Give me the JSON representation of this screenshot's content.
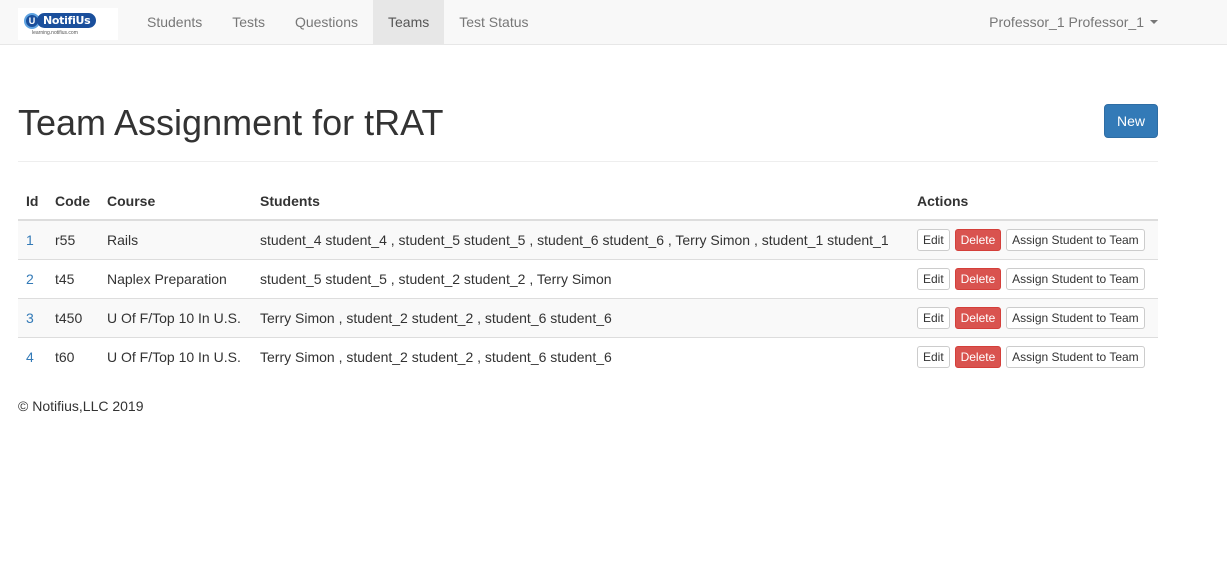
{
  "brand": {
    "name": "NotifiUs",
    "letter": "U",
    "tagline": "learning.notifius.com"
  },
  "nav": {
    "items": [
      {
        "label": "Students"
      },
      {
        "label": "Tests"
      },
      {
        "label": "Questions"
      },
      {
        "label": "Teams",
        "active": true
      },
      {
        "label": "Test Status"
      }
    ],
    "user": "Professor_1 Professor_1"
  },
  "page": {
    "title": "Team Assignment for tRAT",
    "new_label": "New"
  },
  "table": {
    "headers": {
      "id": "Id",
      "code": "Code",
      "course": "Course",
      "students": "Students",
      "actions": "Actions"
    },
    "buttons": {
      "edit": "Edit",
      "delete": "Delete",
      "assign": "Assign Student to Team"
    },
    "rows": [
      {
        "id": "1",
        "code": "r55",
        "course": "Rails",
        "students": "student_4 student_4 , student_5 student_5 , student_6 student_6 , Terry Simon , student_1 student_1"
      },
      {
        "id": "2",
        "code": "t45",
        "course": "Naplex Preparation",
        "students": "student_5 student_5 , student_2 student_2 , Terry Simon"
      },
      {
        "id": "3",
        "code": "t450",
        "course": "U Of F/Top 10 In U.S.",
        "students": "Terry Simon , student_2 student_2 , student_6 student_6"
      },
      {
        "id": "4",
        "code": "t60",
        "course": "U Of F/Top 10 In U.S.",
        "students": "Terry Simon , student_2 student_2 , student_6 student_6"
      }
    ]
  },
  "footer": {
    "text": "© Notifius,LLC 2019"
  },
  "colors": {
    "primary": "#337ab7",
    "danger": "#d9534f",
    "navbar": "#f8f8f8",
    "brand_blue": "#1a4f9c"
  }
}
